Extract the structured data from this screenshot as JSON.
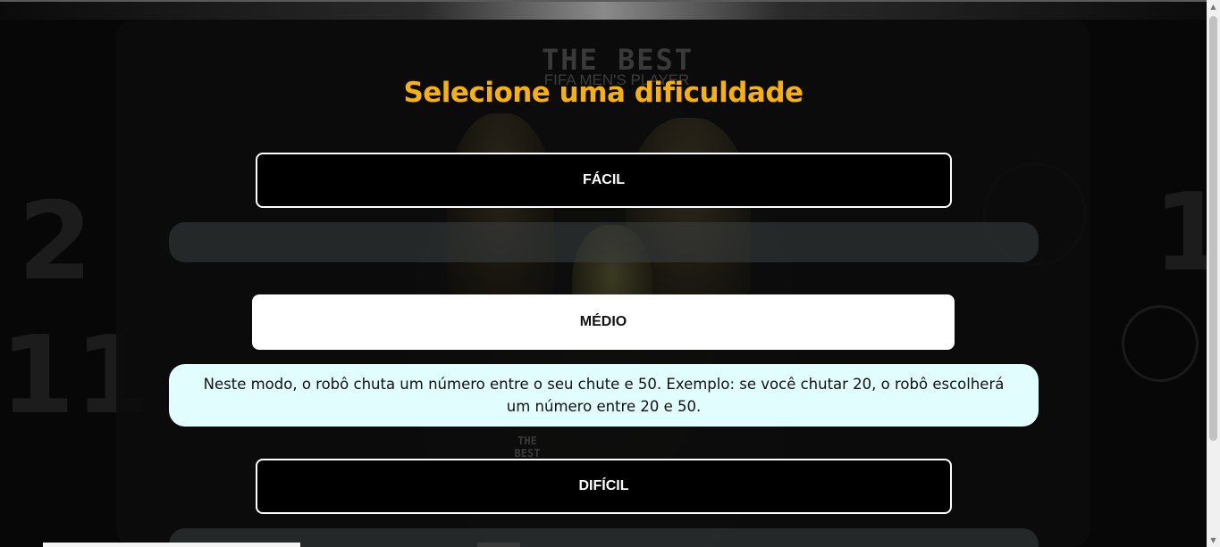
{
  "background": {
    "logo_title": "THE BEST",
    "logo_subtitle": "FIFA MEN'S PLAYER",
    "logo_small": "THE BEST"
  },
  "page": {
    "title": "Selecione uma dificuldade",
    "title_color": "#f7b10f"
  },
  "difficulties": [
    {
      "label": "FÁCIL",
      "selected": false,
      "description": ""
    },
    {
      "label": "MÉDIO",
      "selected": true,
      "description": "Neste modo, o robô chuta um número entre o seu chute e 50. Exemplo: se você chutar 20, o robô escolherá um número entre 20 e 50."
    },
    {
      "label": "DIFÍCIL",
      "selected": false,
      "description": ""
    }
  ],
  "colors": {
    "description_bg": "#e2fdfd",
    "button_border": "#ffffff"
  }
}
